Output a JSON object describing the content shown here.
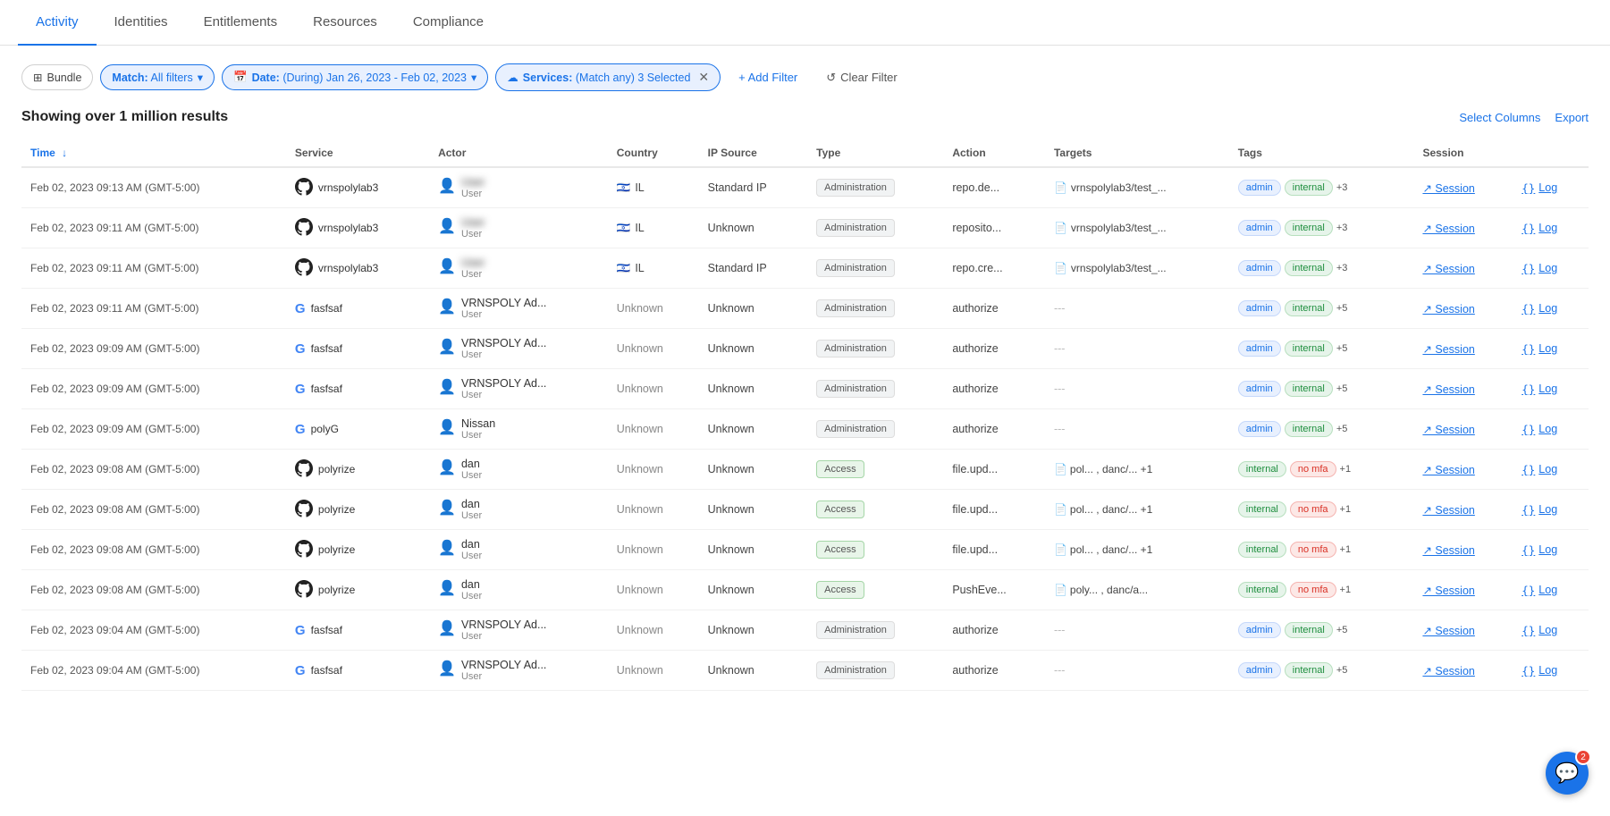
{
  "nav": {
    "tabs": [
      {
        "id": "activity",
        "label": "Activity",
        "active": true
      },
      {
        "id": "identities",
        "label": "Identities",
        "active": false
      },
      {
        "id": "entitlements",
        "label": "Entitlements",
        "active": false
      },
      {
        "id": "resources",
        "label": "Resources",
        "active": false
      },
      {
        "id": "compliance",
        "label": "Compliance",
        "active": false
      }
    ]
  },
  "filters": {
    "bundle": {
      "label": "Bundle",
      "icon": "⊞"
    },
    "match": {
      "label": "Match:",
      "value": "All filters",
      "dropdown": true
    },
    "date": {
      "label": "Date:",
      "value": "(During) Jan 26, 2023 - Feb 02, 2023",
      "dropdown": true
    },
    "services": {
      "label": "Services:",
      "value": "(Match any) 3 Selected",
      "hasClose": true
    },
    "addFilter": "+ Add Filter",
    "clearFilter": "Clear Filter"
  },
  "results": {
    "count": "Showing over 1 million results",
    "selectColumns": "Select Columns",
    "export": "Export"
  },
  "table": {
    "columns": [
      {
        "id": "time",
        "label": "Time",
        "sortable": true,
        "sortActive": true
      },
      {
        "id": "service",
        "label": "Service"
      },
      {
        "id": "actor",
        "label": "Actor"
      },
      {
        "id": "country",
        "label": "Country"
      },
      {
        "id": "ipsource",
        "label": "IP Source"
      },
      {
        "id": "type",
        "label": "Type"
      },
      {
        "id": "action",
        "label": "Action"
      },
      {
        "id": "targets",
        "label": "Targets"
      },
      {
        "id": "tags",
        "label": "Tags"
      },
      {
        "id": "session",
        "label": "Session"
      }
    ],
    "rows": [
      {
        "time": "Feb 02, 2023 09:13 AM (GMT-5:00)",
        "service": "vrnspolylab3",
        "serviceType": "github",
        "actorName": "User",
        "actorRole": "User",
        "actorBlurred": true,
        "country": "IL",
        "flag": "🇮🇱",
        "ipSource": "Standard IP",
        "type": "Administration",
        "action": "repo.de...",
        "targets": "vrnspolylab3/test_...",
        "targetIcon": "file",
        "tagsAdmin": true,
        "tagsInternal": true,
        "tagsPlus": "+3",
        "hasSession": true,
        "hasLog": true
      },
      {
        "time": "Feb 02, 2023 09:11 AM (GMT-5:00)",
        "service": "vrnspolylab3",
        "serviceType": "github",
        "actorName": "User",
        "actorRole": "User",
        "actorBlurred": true,
        "country": "IL",
        "flag": "🇮🇱",
        "ipSource": "Unknown",
        "type": "Administration",
        "action": "reposito...",
        "targets": "vrnspolylab3/test_...",
        "targetIcon": "file",
        "tagsAdmin": true,
        "tagsInternal": true,
        "tagsPlus": "+3",
        "hasSession": true,
        "hasLog": true
      },
      {
        "time": "Feb 02, 2023 09:11 AM (GMT-5:00)",
        "service": "vrnspolylab3",
        "serviceType": "github",
        "actorName": "User",
        "actorRole": "User",
        "actorBlurred": true,
        "country": "IL",
        "flag": "🇮🇱",
        "ipSource": "Standard IP",
        "type": "Administration",
        "action": "repo.cre...",
        "targets": "vrnspolylab3/test_...",
        "targetIcon": "file",
        "tagsAdmin": true,
        "tagsInternal": true,
        "tagsPlus": "+3",
        "hasSession": true,
        "hasLog": true
      },
      {
        "time": "Feb 02, 2023 09:11 AM (GMT-5:00)",
        "service": "fasfsaf",
        "serviceType": "google",
        "actorName": "VRNSPOLY Ad...",
        "actorRole": "User",
        "actorBlurred": false,
        "country": "Unknown",
        "flag": "",
        "ipSource": "Unknown",
        "type": "Administration",
        "action": "authorize",
        "targets": "---",
        "targetIcon": "",
        "tagsAdmin": true,
        "tagsInternal": true,
        "tagsPlus": "+5",
        "hasSession": true,
        "hasLog": true
      },
      {
        "time": "Feb 02, 2023 09:09 AM (GMT-5:00)",
        "service": "fasfsaf",
        "serviceType": "google",
        "actorName": "VRNSPOLY Ad...",
        "actorRole": "User",
        "actorBlurred": false,
        "country": "Unknown",
        "flag": "",
        "ipSource": "Unknown",
        "type": "Administration",
        "action": "authorize",
        "targets": "---",
        "targetIcon": "",
        "tagsAdmin": true,
        "tagsInternal": true,
        "tagsPlus": "+5",
        "hasSession": true,
        "hasLog": true
      },
      {
        "time": "Feb 02, 2023 09:09 AM (GMT-5:00)",
        "service": "fasfsaf",
        "serviceType": "google",
        "actorName": "VRNSPOLY Ad...",
        "actorRole": "User",
        "actorBlurred": false,
        "country": "Unknown",
        "flag": "",
        "ipSource": "Unknown",
        "type": "Administration",
        "action": "authorize",
        "targets": "---",
        "targetIcon": "",
        "tagsAdmin": true,
        "tagsInternal": true,
        "tagsPlus": "+5",
        "hasSession": true,
        "hasLog": true
      },
      {
        "time": "Feb 02, 2023 09:09 AM (GMT-5:00)",
        "service": "polyG",
        "serviceType": "google",
        "actorName": "Nissan",
        "actorRole": "User",
        "actorBlurred": false,
        "country": "Unknown",
        "flag": "",
        "ipSource": "Unknown",
        "type": "Administration",
        "action": "authorize",
        "targets": "---",
        "targetIcon": "",
        "tagsAdmin": true,
        "tagsInternal": true,
        "tagsPlus": "+5",
        "hasSession": true,
        "hasLog": true
      },
      {
        "time": "Feb 02, 2023 09:08 AM (GMT-5:00)",
        "service": "polyrize",
        "serviceType": "github",
        "actorName": "dan",
        "actorRole": "User",
        "actorBlurred": false,
        "country": "Unknown",
        "flag": "",
        "ipSource": "Unknown",
        "type": "Access",
        "action": "file.upd...",
        "targets": "pol... , danc/... +1",
        "targetIcon": "multi",
        "tagsAdmin": false,
        "tagsInternal": true,
        "tagsNoMfa": true,
        "tagsPlus": "+1",
        "hasSession": true,
        "hasLog": true
      },
      {
        "time": "Feb 02, 2023 09:08 AM (GMT-5:00)",
        "service": "polyrize",
        "serviceType": "github",
        "actorName": "dan",
        "actorRole": "User",
        "actorBlurred": false,
        "country": "Unknown",
        "flag": "",
        "ipSource": "Unknown",
        "type": "Access",
        "action": "file.upd...",
        "targets": "pol... , danc/... +1",
        "targetIcon": "multi",
        "tagsAdmin": false,
        "tagsInternal": true,
        "tagsNoMfa": true,
        "tagsPlus": "+1",
        "hasSession": true,
        "hasLog": true
      },
      {
        "time": "Feb 02, 2023 09:08 AM (GMT-5:00)",
        "service": "polyrize",
        "serviceType": "github",
        "actorName": "dan",
        "actorRole": "User",
        "actorBlurred": false,
        "country": "Unknown",
        "flag": "",
        "ipSource": "Unknown",
        "type": "Access",
        "action": "file.upd...",
        "targets": "pol... , danc/... +1",
        "targetIcon": "multi",
        "tagsAdmin": false,
        "tagsInternal": true,
        "tagsNoMfa": true,
        "tagsPlus": "+1",
        "hasSession": true,
        "hasLog": true
      },
      {
        "time": "Feb 02, 2023 09:08 AM (GMT-5:00)",
        "service": "polyrize",
        "serviceType": "github",
        "actorName": "dan",
        "actorRole": "User",
        "actorBlurred": false,
        "country": "Unknown",
        "flag": "",
        "ipSource": "Unknown",
        "type": "Access",
        "action": "PushEve...",
        "targets": "poly... , danc/a...",
        "targetIcon": "multi",
        "tagsAdmin": false,
        "tagsInternal": true,
        "tagsNoMfa": true,
        "tagsPlus": "+1",
        "hasSession": true,
        "hasLog": true
      },
      {
        "time": "Feb 02, 2023 09:04 AM (GMT-5:00)",
        "service": "fasfsaf",
        "serviceType": "google",
        "actorName": "VRNSPOLY Ad...",
        "actorRole": "User",
        "actorBlurred": false,
        "country": "Unknown",
        "flag": "",
        "ipSource": "Unknown",
        "type": "Administration",
        "action": "authorize",
        "targets": "---",
        "targetIcon": "",
        "tagsAdmin": true,
        "tagsInternal": true,
        "tagsPlus": "+5",
        "hasSession": true,
        "hasLog": true
      },
      {
        "time": "Feb 02, 2023 09:04 AM (GMT-5:00)",
        "service": "fasfsaf",
        "serviceType": "google",
        "actorName": "VRNSPOLY Ad...",
        "actorRole": "User",
        "actorBlurred": false,
        "country": "Unknown",
        "flag": "",
        "ipSource": "Unknown",
        "type": "Administration",
        "action": "authorize",
        "targets": "---",
        "targetIcon": "",
        "tagsAdmin": true,
        "tagsInternal": true,
        "tagsPlus": "+5",
        "hasSession": true,
        "hasLog": true
      }
    ]
  },
  "chat": {
    "badge": "2"
  },
  "labels": {
    "session": "Session",
    "log": "Log",
    "internal": "internal",
    "admin": "admin",
    "nomfa": "no mfa"
  }
}
